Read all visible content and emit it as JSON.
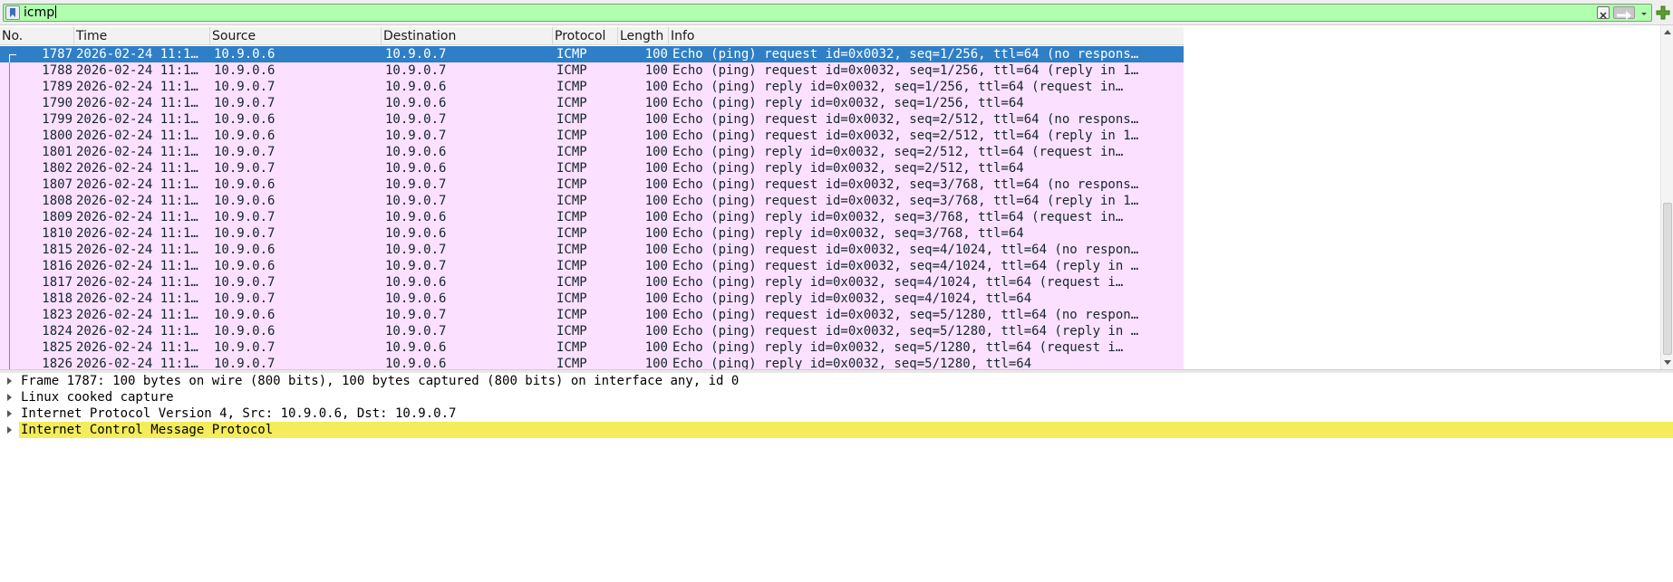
{
  "filter": {
    "value": "icmp"
  },
  "columns": [
    "No.",
    "Time",
    "Source",
    "Destination",
    "Protocol",
    "Length",
    "Info"
  ],
  "packets": [
    {
      "no": "1787",
      "time": "2026-02-24 11:1…",
      "src": "10.9.0.6",
      "dst": "10.9.0.7",
      "proto": "ICMP",
      "len": "100",
      "info": "Echo (ping) request  id=0x0032, seq=1/256, ttl=64 (no respons…",
      "selected": true
    },
    {
      "no": "1788",
      "time": "2026-02-24 11:1…",
      "src": "10.9.0.6",
      "dst": "10.9.0.7",
      "proto": "ICMP",
      "len": "100",
      "info": "Echo (ping) request  id=0x0032, seq=1/256, ttl=64 (reply in 1…"
    },
    {
      "no": "1789",
      "time": "2026-02-24 11:1…",
      "src": "10.9.0.7",
      "dst": "10.9.0.6",
      "proto": "ICMP",
      "len": "100",
      "info": "Echo (ping) reply    id=0x0032, seq=1/256, ttl=64 (request in…"
    },
    {
      "no": "1790",
      "time": "2026-02-24 11:1…",
      "src": "10.9.0.7",
      "dst": "10.9.0.6",
      "proto": "ICMP",
      "len": "100",
      "info": "Echo (ping) reply    id=0x0032, seq=1/256, ttl=64"
    },
    {
      "no": "1799",
      "time": "2026-02-24 11:1…",
      "src": "10.9.0.6",
      "dst": "10.9.0.7",
      "proto": "ICMP",
      "len": "100",
      "info": "Echo (ping) request  id=0x0032, seq=2/512, ttl=64 (no respons…"
    },
    {
      "no": "1800",
      "time": "2026-02-24 11:1…",
      "src": "10.9.0.6",
      "dst": "10.9.0.7",
      "proto": "ICMP",
      "len": "100",
      "info": "Echo (ping) request  id=0x0032, seq=2/512, ttl=64 (reply in 1…"
    },
    {
      "no": "1801",
      "time": "2026-02-24 11:1…",
      "src": "10.9.0.7",
      "dst": "10.9.0.6",
      "proto": "ICMP",
      "len": "100",
      "info": "Echo (ping) reply    id=0x0032, seq=2/512, ttl=64 (request in…"
    },
    {
      "no": "1802",
      "time": "2026-02-24 11:1…",
      "src": "10.9.0.7",
      "dst": "10.9.0.6",
      "proto": "ICMP",
      "len": "100",
      "info": "Echo (ping) reply    id=0x0032, seq=2/512, ttl=64"
    },
    {
      "no": "1807",
      "time": "2026-02-24 11:1…",
      "src": "10.9.0.6",
      "dst": "10.9.0.7",
      "proto": "ICMP",
      "len": "100",
      "info": "Echo (ping) request  id=0x0032, seq=3/768, ttl=64 (no respons…"
    },
    {
      "no": "1808",
      "time": "2026-02-24 11:1…",
      "src": "10.9.0.6",
      "dst": "10.9.0.7",
      "proto": "ICMP",
      "len": "100",
      "info": "Echo (ping) request  id=0x0032, seq=3/768, ttl=64 (reply in 1…"
    },
    {
      "no": "1809",
      "time": "2026-02-24 11:1…",
      "src": "10.9.0.7",
      "dst": "10.9.0.6",
      "proto": "ICMP",
      "len": "100",
      "info": "Echo (ping) reply    id=0x0032, seq=3/768, ttl=64 (request in…"
    },
    {
      "no": "1810",
      "time": "2026-02-24 11:1…",
      "src": "10.9.0.7",
      "dst": "10.9.0.6",
      "proto": "ICMP",
      "len": "100",
      "info": "Echo (ping) reply    id=0x0032, seq=3/768, ttl=64"
    },
    {
      "no": "1815",
      "time": "2026-02-24 11:1…",
      "src": "10.9.0.6",
      "dst": "10.9.0.7",
      "proto": "ICMP",
      "len": "100",
      "info": "Echo (ping) request  id=0x0032, seq=4/1024, ttl=64 (no respon…"
    },
    {
      "no": "1816",
      "time": "2026-02-24 11:1…",
      "src": "10.9.0.6",
      "dst": "10.9.0.7",
      "proto": "ICMP",
      "len": "100",
      "info": "Echo (ping) request  id=0x0032, seq=4/1024, ttl=64 (reply in …"
    },
    {
      "no": "1817",
      "time": "2026-02-24 11:1…",
      "src": "10.9.0.7",
      "dst": "10.9.0.6",
      "proto": "ICMP",
      "len": "100",
      "info": "Echo (ping) reply    id=0x0032, seq=4/1024, ttl=64 (request i…"
    },
    {
      "no": "1818",
      "time": "2026-02-24 11:1…",
      "src": "10.9.0.7",
      "dst": "10.9.0.6",
      "proto": "ICMP",
      "len": "100",
      "info": "Echo (ping) reply    id=0x0032, seq=4/1024, ttl=64"
    },
    {
      "no": "1823",
      "time": "2026-02-24 11:1…",
      "src": "10.9.0.6",
      "dst": "10.9.0.7",
      "proto": "ICMP",
      "len": "100",
      "info": "Echo (ping) request  id=0x0032, seq=5/1280, ttl=64 (no respon…"
    },
    {
      "no": "1824",
      "time": "2026-02-24 11:1…",
      "src": "10.9.0.6",
      "dst": "10.9.0.7",
      "proto": "ICMP",
      "len": "100",
      "info": "Echo (ping) request  id=0x0032, seq=5/1280, ttl=64 (reply in …"
    },
    {
      "no": "1825",
      "time": "2026-02-24 11:1…",
      "src": "10.9.0.7",
      "dst": "10.9.0.6",
      "proto": "ICMP",
      "len": "100",
      "info": "Echo (ping) reply    id=0x0032, seq=5/1280, ttl=64 (request i…"
    },
    {
      "no": "1826",
      "time": "2026-02-24 11:1…",
      "src": "10.9.0.7",
      "dst": "10.9.0.6",
      "proto": "ICMP",
      "len": "100",
      "info": "Echo (ping) reply    id=0x0032, seq=5/1280, ttl=64"
    }
  ],
  "details": [
    {
      "label": "Frame 1787: 100 bytes on wire (800 bits), 100 bytes captured (800 bits) on interface any, id 0"
    },
    {
      "label": "Linux cooked capture"
    },
    {
      "label": "Internet Protocol Version 4, Src: 10.9.0.6, Dst: 10.9.0.7"
    },
    {
      "label": "Internet Control Message Protocol",
      "highlight": true
    }
  ],
  "colors": {
    "filter_valid_bg": "#afffaf",
    "icmp_row_bg": "#fce0ff",
    "selected_row_bg": "#2f7fc6",
    "highlight_bg": "#f5ec5b"
  }
}
